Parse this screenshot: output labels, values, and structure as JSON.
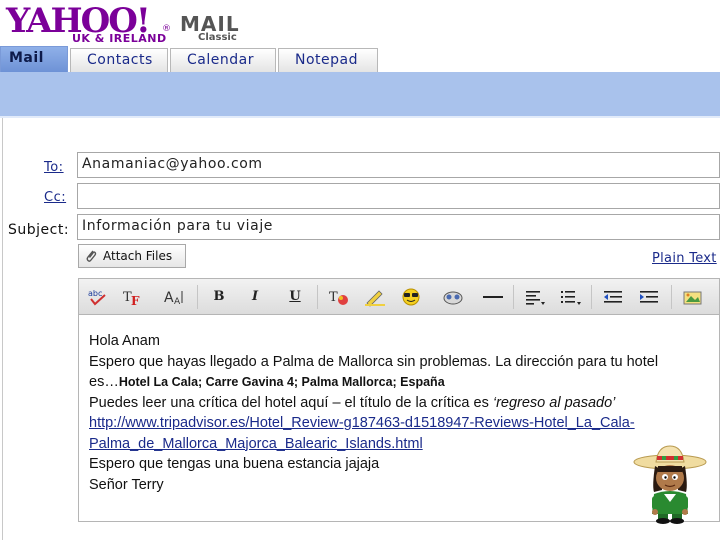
{
  "logo": {
    "brand": "YAHOO!",
    "region": "UK & IRELAND",
    "product": "MAIL",
    "edition": "Classic"
  },
  "tabs": [
    {
      "label": "Mail",
      "active": true
    },
    {
      "label": "Contacts"
    },
    {
      "label": "Calendar"
    },
    {
      "label": "Notepad"
    }
  ],
  "compose": {
    "to_label": "To:",
    "to_value": "Anamaniac@yahoo.com",
    "cc_label": "Cc:",
    "cc_value": "",
    "subject_label": "Subject:",
    "subject_value": "Información para tu viaje",
    "attach_label": "Attach Files",
    "plain_text_label": "Plain Text"
  },
  "toolbar_icons": [
    "spellcheck-icon",
    "font-icon",
    "font-size-icon",
    "bold-icon",
    "italic-icon",
    "underline-icon",
    "text-color-icon",
    "highlight-icon",
    "emoticon-icon",
    "stationery-icon",
    "horizontal-rule-icon",
    "align-icon",
    "list-icon",
    "outdent-icon",
    "indent-icon",
    "insert-image-icon"
  ],
  "toolbar_glyphs": {
    "bold": "B",
    "italic": "I",
    "underline": "U"
  },
  "body": {
    "line1": "Hola Anam",
    "line2": "Espero que hayas llegado a Palma de Mallorca sin problemas. La dirección para tu hotel",
    "line3_prefix": "es…",
    "line3_address": "Hotel La Cala; Carre Gavina 4; Palma Mallorca; España",
    "line4_a": "Puedes leer ",
    "line4_b": "una crítica",
    "line4_c": " del hotel aquí – el título de la crítica es ",
    "line4_d": "‘regreso al pasado’",
    "link_part1": "http://www.tripadvisor.es/Hotel_Review-g187463-d1518947-Reviews-Hotel_La_Cala-",
    "link_part2": "Palma_de_Mallorca_Majorca_Balearic_Islands.html",
    "line6": "Espero que tengas una buena estancia jajaja",
    "line7": "Señor Terry"
  },
  "colors": {
    "brand_purple": "#7b0099",
    "tab_active": "#6e92d6",
    "band": "#a9c2ec",
    "link": "#1a2a8a"
  }
}
